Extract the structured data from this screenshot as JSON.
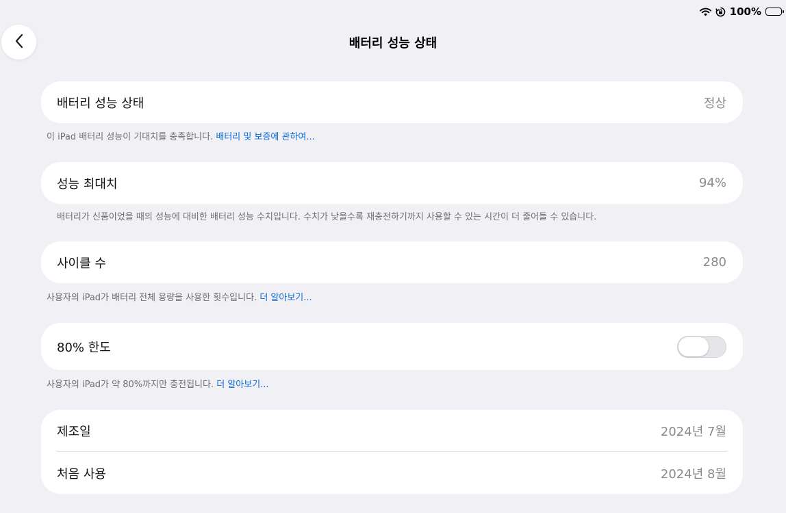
{
  "status_bar": {
    "battery_percent": "100%",
    "wifi_icon": "wifi-icon",
    "orientation_lock_icon": "orientation-lock-icon",
    "battery_icon": "battery-full-icon"
  },
  "nav": {
    "back_icon": "chevron-left-icon",
    "title": "배터리 성능 상태"
  },
  "battery_health": {
    "label": "배터리 성능 상태",
    "value": "정상",
    "footnote": "이 iPad 배터리 성능이 기대치를 충족합니다.",
    "footnote_link": "배터리 및 보증에 관하여..."
  },
  "max_capacity": {
    "label": "성능 최대치",
    "value": "94%",
    "footnote": "배터리가 신품이었을 때의 성능에 대비한 배터리 성능 수치입니다. 수치가 낮을수록 재충전하기까지 사용할 수 있는 시간이 더 줄어들 수 있습니다."
  },
  "cycle_count": {
    "label": "사이클 수",
    "value": "280",
    "footnote": "사용자의 iPad가 배터리 전체 용량을 사용한 횟수입니다.",
    "footnote_link": "더 알아보기..."
  },
  "limit_80": {
    "label": "80% 한도",
    "toggle_on": false,
    "footnote": "사용자의 iPad가 약 80%까지만 충전됩니다.",
    "footnote_link": "더 알아보기..."
  },
  "dates": {
    "manufacture_label": "제조일",
    "manufacture_value": "2024년 7월",
    "first_use_label": "처음 사용",
    "first_use_value": "2024년 8월"
  },
  "colors": {
    "background": "#f0f0f5",
    "link": "#0a6cd6",
    "secondary_text": "#8a8a8e"
  }
}
